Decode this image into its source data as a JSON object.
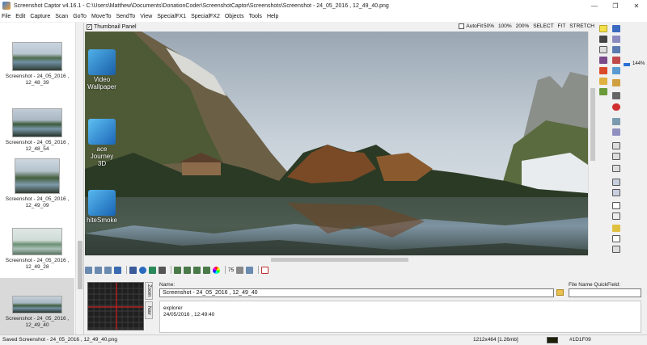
{
  "window": {
    "title": "Screenshot Captor v4.16.1 - C:\\Users\\Matthew\\Documents\\DonationCoder\\ScreenshotCaptor\\Screenshots\\Screenshot - 24_05_2016 , 12_49_40.png",
    "controls": {
      "minimize": "—",
      "maximize": "❐",
      "close": "✕"
    }
  },
  "menu": [
    "File",
    "Edit",
    "Capture",
    "Scan",
    "GoTo",
    "MoveTo",
    "SendTo",
    "View",
    "SpecialFX1",
    "SpecialFX2",
    "Objects",
    "Tools",
    "Help"
  ],
  "thumbnails": [
    {
      "caption_line1": "Screenshot - 24_05_2016 ,",
      "caption_line2": "12_48_39",
      "selected": false
    },
    {
      "caption_line1": "Screenshot - 24_05_2016 ,",
      "caption_line2": "12_48_54",
      "selected": false
    },
    {
      "caption_line1": "Screenshot - 24_05_2016 ,",
      "caption_line2": "12_49_09",
      "selected": false
    },
    {
      "caption_line1": "Screenshot - 24_05_2016 ,",
      "caption_line2": "12_49_28",
      "selected": false
    },
    {
      "caption_line1": "Screenshot - 24_05_2016 ,",
      "caption_line2": "12_49_40",
      "selected": true
    }
  ],
  "viewer": {
    "thumbnail_panel_label": "Thumbnail Panel",
    "thumbnail_panel_checked": true,
    "autofit_label": "AutoFit",
    "autofit_checked": false,
    "zoom_options": [
      "50%",
      "100%",
      "200%",
      "SELECT",
      "FIT",
      "STRETCH"
    ],
    "zoom_percent": "144%"
  },
  "desktop_icons": [
    {
      "line1": "Video",
      "line2": "Wallpaper"
    },
    {
      "line1": "ace Journey",
      "line2": "3D"
    },
    {
      "line1": "hiteSmoke",
      "line2": ""
    }
  ],
  "bottom_toolbar": {
    "quality_value": "75"
  },
  "bottom_panel": {
    "zoom_tab": "Zoom",
    "nav_tab": "Nav",
    "name_label": "Name:",
    "name_value": "Screenshot - 24_05_2016 , 12_49_40",
    "quickfield_label": "File Name QuickField:",
    "quickfield_value": "",
    "notes_line1": "explorer",
    "notes_line2": "24/05/2016 , 12:49:40"
  },
  "status": {
    "message": "Saved Screenshot - 24_05_2016 , 12_49_40.png",
    "dimensions": "1212x464  [1.26mb]",
    "color_hex": "#1D1F09",
    "swatch_color": "#1D1F09"
  }
}
